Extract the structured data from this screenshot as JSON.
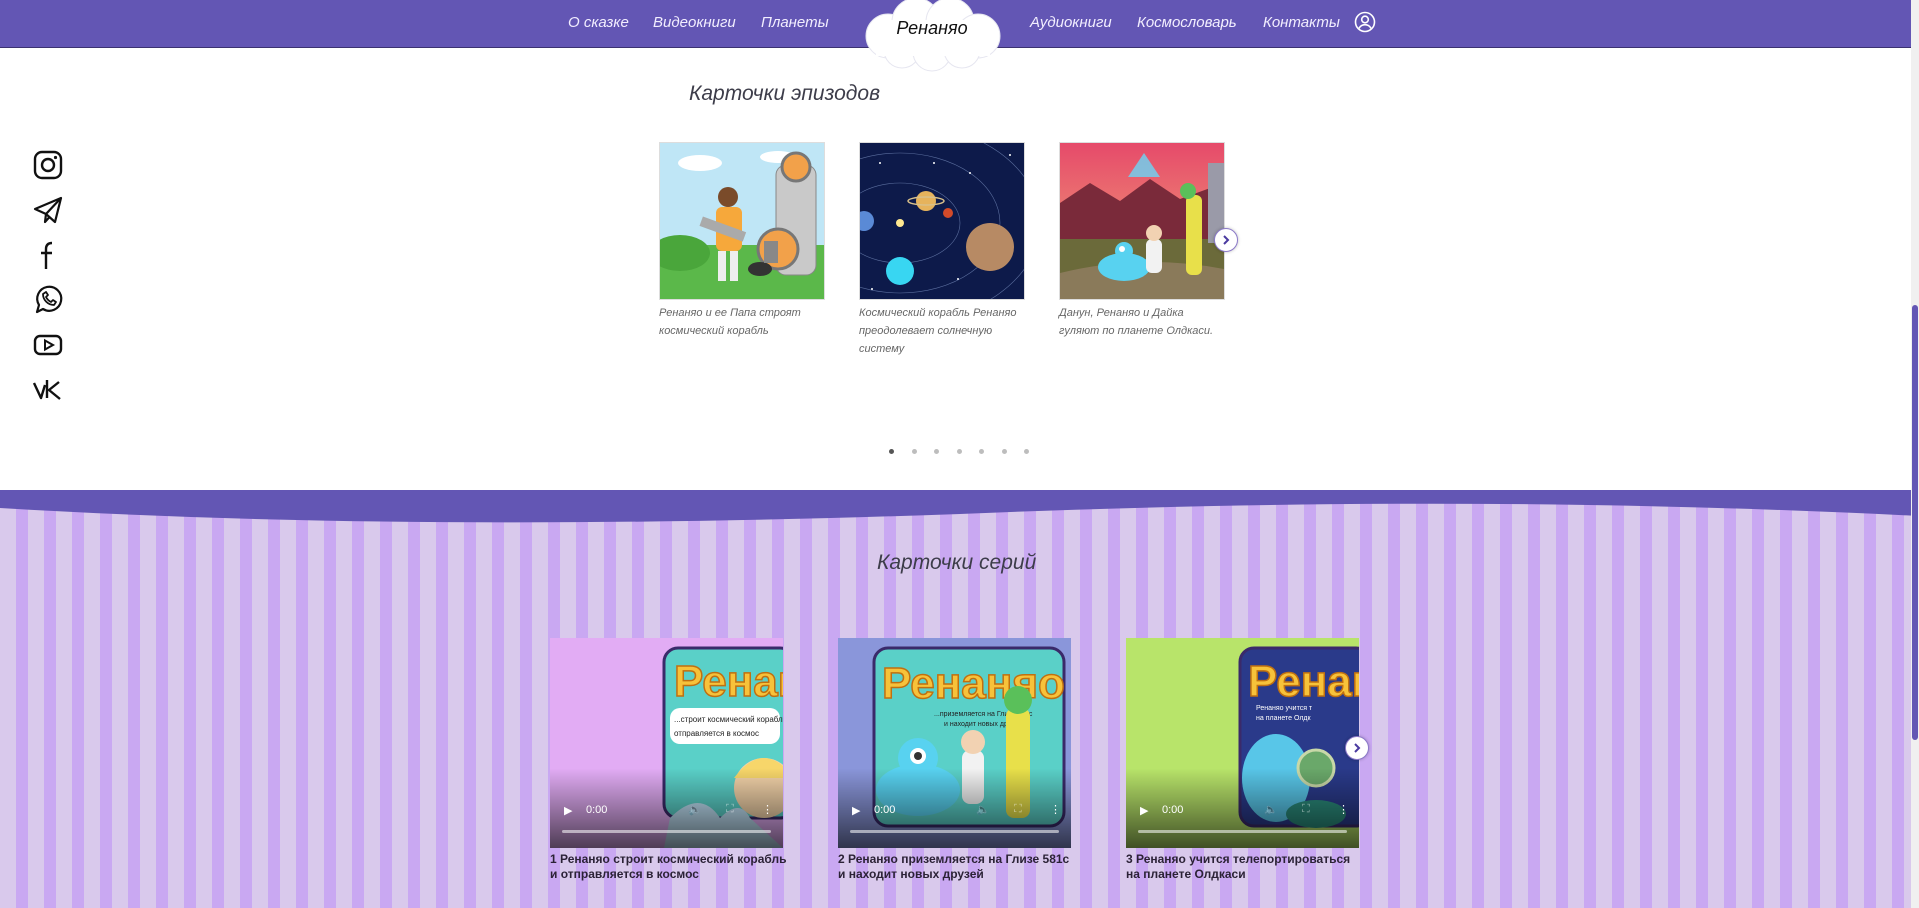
{
  "header": {
    "nav_left": [
      "О сказке",
      "Видеокниги",
      "Планеты"
    ],
    "logo": "Ренаняо",
    "nav_right": [
      "Аудиокниги",
      "Космословарь",
      "Контакты"
    ],
    "user_icon": "user-circle-icon"
  },
  "social": [
    "instagram-icon",
    "telegram-icon",
    "facebook-icon",
    "whatsapp-icon",
    "youtube-icon",
    "vk-icon"
  ],
  "episodes": {
    "title": "Карточки эпизодов",
    "cards": [
      {
        "caption": "Ренаняо и ее Папа строят космический корабль"
      },
      {
        "caption": "Космический корабль Ренаняо преодолевает солнечную систему"
      },
      {
        "caption": "Данун, Ренаняо и Дайка гуляют по планете Олдкаси."
      }
    ],
    "dots_count": 7,
    "active_dot": 1
  },
  "series": {
    "title": "Карточки серий",
    "videos": [
      {
        "title": "1 Ренаняо строит космический корабль и отправляется в космос",
        "time": "0:00",
        "poster_text": "...строит космический корабль и отправляется в космос"
      },
      {
        "title": "2 Ренаняо приземляется на Глизе 581с и находит новых друзей",
        "time": "0:00",
        "poster_text": "...приземляется на Глизе 581с и находит новых друзей"
      },
      {
        "title": "3 Ренаняо учится телепортироваться на планете Олдкаси",
        "time": "0:00",
        "poster_text": "Ренаняо учится т... на планете Олдк..."
      }
    ]
  },
  "colors": {
    "brand_purple": "#6356b4",
    "stripe_light": "#d9c9ec",
    "stripe_dark": "#c9a8f2"
  }
}
